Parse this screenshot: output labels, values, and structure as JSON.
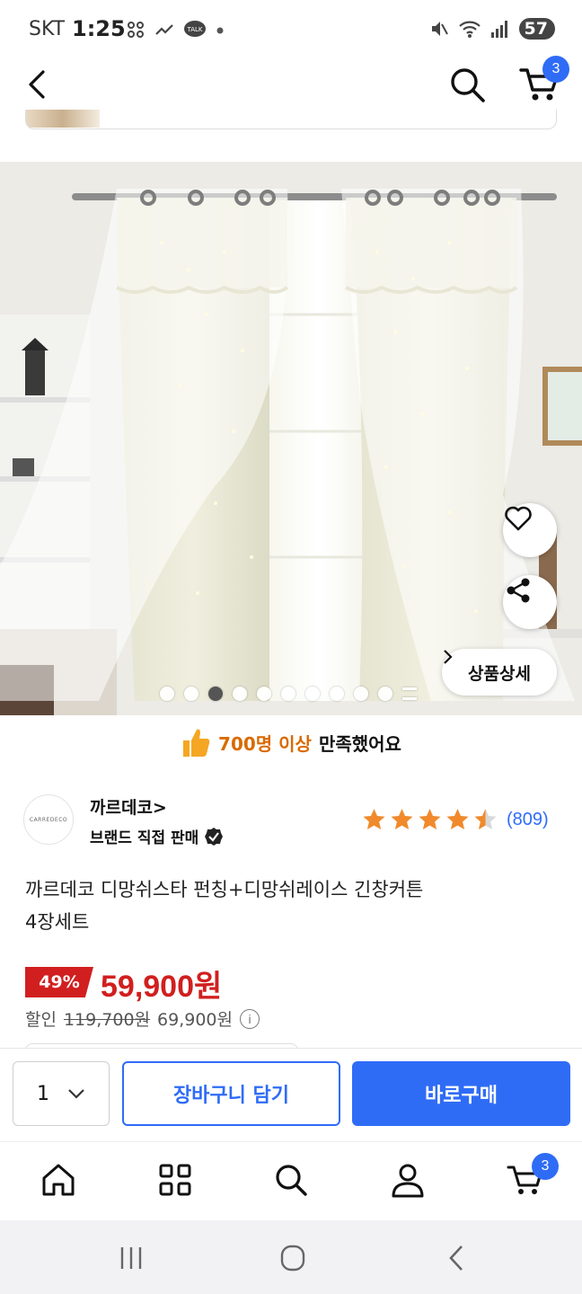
{
  "status_bar": {
    "carrier": "SKT",
    "time": "1:25",
    "battery": "57"
  },
  "header": {
    "cart_count": "3"
  },
  "gallery": {
    "total_dots": 10,
    "active_index": 2,
    "detail_label": "상품상세"
  },
  "satisfaction": {
    "highlight": "700명 이상",
    "rest": "만족했어요"
  },
  "brand": {
    "logo_text": "CARREDECO",
    "name": "까르데코>",
    "badge_label": "브랜드 직접 판매"
  },
  "rating": {
    "stars": 4.5,
    "count": "(809)"
  },
  "product": {
    "title_line1": "까르데코 디망쉬스타 펀칭+디망쉬레이스 긴창커튼",
    "title_line2": "4장세트"
  },
  "pricing": {
    "discount": "49%",
    "price": "59,900원",
    "sale_label": "할인",
    "original_price": "119,700원",
    "intermediate_price": "69,900원"
  },
  "action_bar": {
    "quantity": "1",
    "add_to_cart": "장바구니 담기",
    "buy_now": "바로구매"
  },
  "bottom_nav": {
    "cart_count": "3"
  },
  "colors": {
    "accent": "#2f6cf6",
    "price_red": "#d11f1f",
    "highlight_orange": "#d96a00",
    "star": "#f08a2c"
  }
}
